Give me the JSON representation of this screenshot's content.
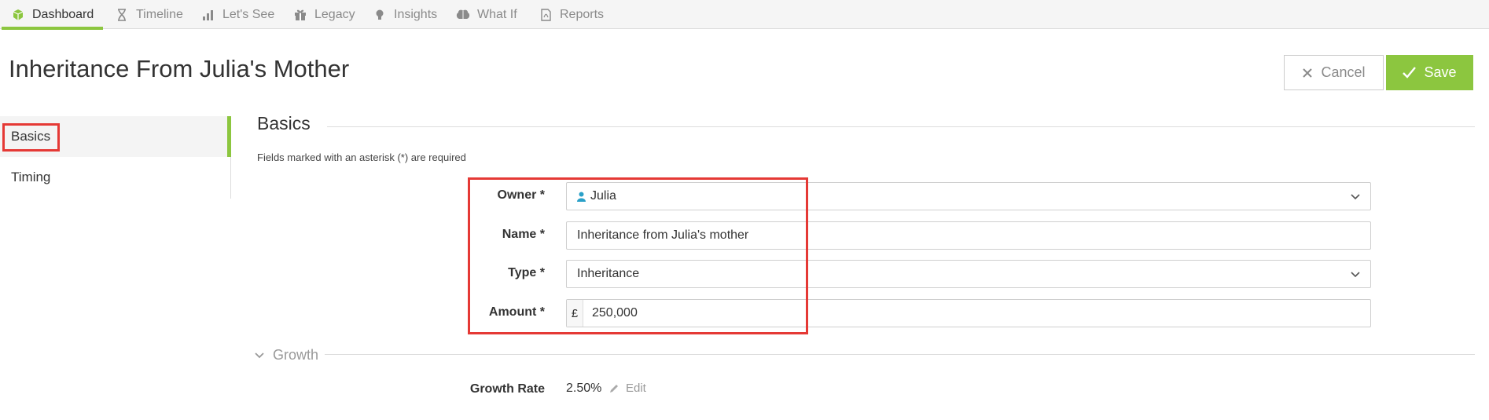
{
  "nav": {
    "tabs": [
      {
        "label": "Dashboard",
        "icon": "cube-icon"
      },
      {
        "label": "Timeline",
        "icon": "hourglass-icon"
      },
      {
        "label": "Let's See",
        "icon": "bar-chart-icon"
      },
      {
        "label": "Legacy",
        "icon": "gift-icon"
      },
      {
        "label": "Insights",
        "icon": "lightbulb-icon"
      },
      {
        "label": "What If",
        "icon": "brain-icon"
      },
      {
        "label": "Reports",
        "icon": "pdf-icon"
      }
    ],
    "active_tab": "Dashboard"
  },
  "page": {
    "title": "Inheritance From Julia's Mother",
    "cancel_label": "Cancel",
    "save_label": "Save"
  },
  "sidebar": {
    "items": [
      {
        "label": "Basics",
        "active": true
      },
      {
        "label": "Timing",
        "active": false
      }
    ]
  },
  "basics": {
    "section_title": "Basics",
    "required_note": "Fields marked with an asterisk (*) are required",
    "owner": {
      "label": "Owner *",
      "value": "Julia"
    },
    "name": {
      "label": "Name *",
      "value": "Inheritance from Julia's mother"
    },
    "type": {
      "label": "Type *",
      "value": "Inheritance"
    },
    "amount": {
      "label": "Amount *",
      "currency": "£",
      "value": "250,000"
    }
  },
  "growth": {
    "section_title": "Growth",
    "rate_label": "Growth Rate",
    "rate_value": "2.50%",
    "edit_label": "Edit"
  },
  "colors": {
    "accent": "#8cc63f",
    "highlight": "#e53935",
    "person_icon": "#2aa0c8"
  }
}
